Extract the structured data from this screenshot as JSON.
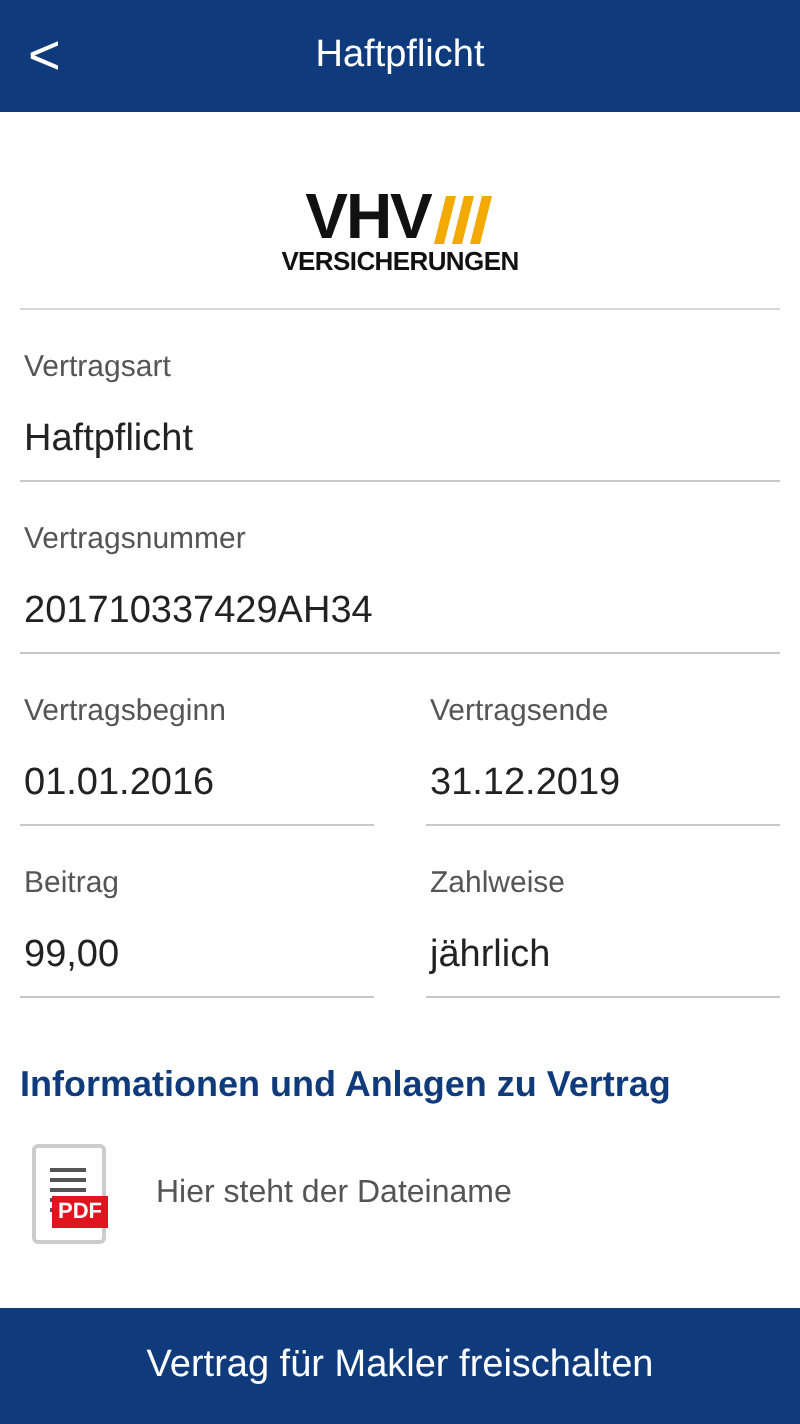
{
  "header": {
    "back": "<",
    "title": "Haftpflicht"
  },
  "logo": {
    "name": "VHV",
    "subtitle": "VERSICHERUNGEN"
  },
  "rows": [
    [
      {
        "label": "Vertragsart",
        "value": "Haftpflicht"
      }
    ],
    [
      {
        "label": "Vertragsnummer",
        "value": "201710337429AH34"
      }
    ],
    [
      {
        "label": "Vertragsbeginn",
        "value": "01.01.2016"
      },
      {
        "label": "Vertragsende",
        "value": "31.12.2019"
      }
    ],
    [
      {
        "label": "Beitrag",
        "value": "99,00"
      },
      {
        "label": "Zahlweise",
        "value": "jährlich"
      }
    ]
  ],
  "section_title": "Informationen und Anlagen zu Vertrag",
  "attachments": [
    {
      "badge": "PDF",
      "name": "Hier steht der Dateiname"
    }
  ],
  "footer_button": "Vertrag für Makler freischalten"
}
